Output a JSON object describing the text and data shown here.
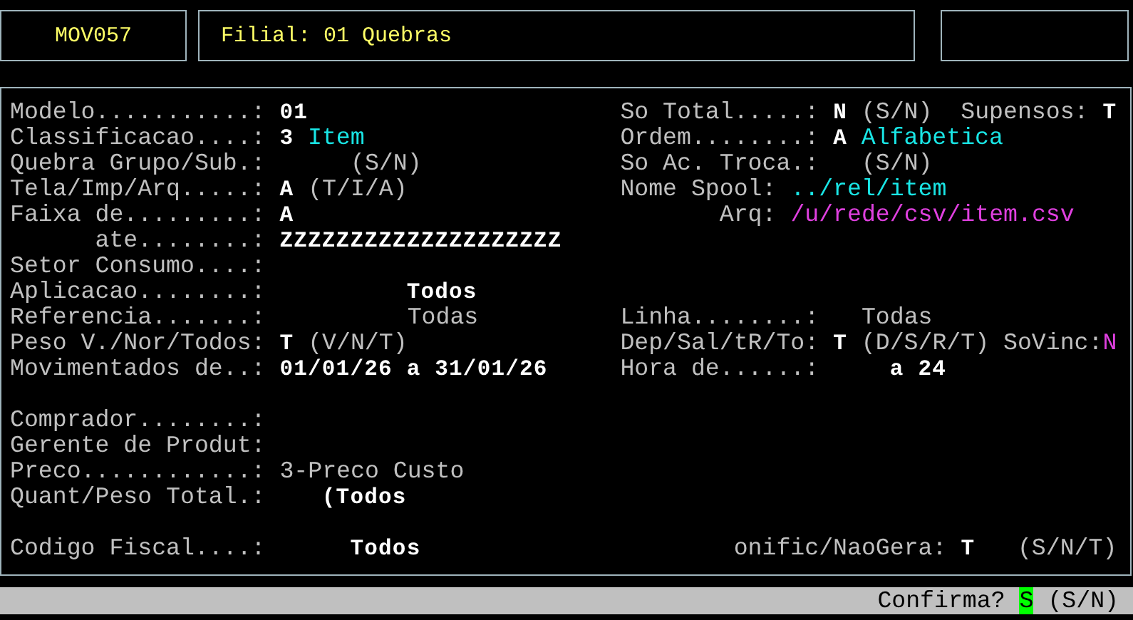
{
  "header": {
    "program_code": "MOV057",
    "title": "Filial: 01 Quebras"
  },
  "lines": [
    {
      "kind": "fields",
      "left": [
        {
          "text": "Modelo...........: ",
          "kind": "label"
        },
        {
          "text": "01",
          "kind": "value"
        }
      ],
      "right": [
        {
          "text": "So Total.....: ",
          "kind": "label"
        },
        {
          "text": "N",
          "kind": "value"
        },
        {
          "text": " (S/N)  Supensos: ",
          "kind": "label"
        },
        {
          "text": "T",
          "kind": "value"
        }
      ]
    },
    {
      "kind": "fields",
      "left": [
        {
          "text": "Classificacao....: ",
          "kind": "label"
        },
        {
          "text": "3 ",
          "kind": "value"
        },
        {
          "text": "Item",
          "kind": "cyan"
        }
      ],
      "right": [
        {
          "text": "Ordem........: ",
          "kind": "label"
        },
        {
          "text": "A ",
          "kind": "value"
        },
        {
          "text": "Alfabetica",
          "kind": "cyan"
        }
      ]
    },
    {
      "kind": "fields",
      "left": [
        {
          "text": "Quebra Grupo/Sub.:      (S/N)",
          "kind": "label"
        }
      ],
      "right": [
        {
          "text": "So Ac. Troca.:   (S/N)",
          "kind": "label"
        }
      ]
    },
    {
      "kind": "fields",
      "left": [
        {
          "text": "Tela/Imp/Arq.....: ",
          "kind": "label"
        },
        {
          "text": "A",
          "kind": "value"
        },
        {
          "text": " (T/I/A)",
          "kind": "label"
        }
      ],
      "right": [
        {
          "text": "Nome Spool: ",
          "kind": "label"
        },
        {
          "text": "../rel/item",
          "kind": "cyan"
        }
      ]
    },
    {
      "kind": "fields",
      "left": [
        {
          "text": "Faixa de.........: ",
          "kind": "label"
        },
        {
          "text": "A",
          "kind": "value"
        }
      ],
      "right": [
        {
          "text": "       Arq: ",
          "kind": "label"
        },
        {
          "text": "/u/rede/csv/item.csv",
          "kind": "magenta"
        }
      ]
    },
    {
      "kind": "fields",
      "left": [
        {
          "text": "      ate........: ",
          "kind": "label"
        },
        {
          "text": "ZZZZZZZZZZZZZZZZZZZZ",
          "kind": "value"
        }
      ]
    },
    {
      "kind": "fields",
      "left": [
        {
          "text": "Setor Consumo....:",
          "kind": "label"
        }
      ]
    },
    {
      "kind": "fields",
      "left": [
        {
          "text": "Aplicacao........: ",
          "kind": "label"
        },
        {
          "text": "         Todos",
          "kind": "value"
        }
      ]
    },
    {
      "kind": "fields",
      "left": [
        {
          "text": "Referencia.......: ",
          "kind": "label"
        },
        {
          "text": "         Todas",
          "kind": "label"
        }
      ],
      "right": [
        {
          "text": "Linha........:   Todas",
          "kind": "label"
        }
      ]
    },
    {
      "kind": "fields",
      "left": [
        {
          "text": "Peso V./Nor/Todos: ",
          "kind": "label"
        },
        {
          "text": "T",
          "kind": "value"
        },
        {
          "text": " (V/N/T)",
          "kind": "label"
        }
      ],
      "right": [
        {
          "text": "Dep/Sal/tR/To: ",
          "kind": "label"
        },
        {
          "text": "T",
          "kind": "value"
        },
        {
          "text": " (D/S/R/T) SoVinc:",
          "kind": "label"
        },
        {
          "text": "N",
          "kind": "magenta"
        }
      ]
    },
    {
      "kind": "fields",
      "left": [
        {
          "text": "Movimentados de..: ",
          "kind": "label"
        },
        {
          "text": "01/01/26 a 31/01/26",
          "kind": "value"
        }
      ],
      "right": [
        {
          "text": "Hora de......:     ",
          "kind": "label"
        },
        {
          "text": "a 24",
          "kind": "value"
        }
      ]
    },
    {
      "kind": "blank"
    },
    {
      "kind": "fields",
      "left": [
        {
          "text": "Comprador........:",
          "kind": "label"
        }
      ]
    },
    {
      "kind": "fields",
      "left": [
        {
          "text": "Gerente de Produt:",
          "kind": "label"
        }
      ]
    },
    {
      "kind": "fields",
      "left": [
        {
          "text": "Preco............: ",
          "kind": "label"
        },
        {
          "text": "3-Preco Custo",
          "kind": "label"
        }
      ]
    },
    {
      "kind": "fields",
      "left": [
        {
          "text": "Quant/Peso Total.: ",
          "kind": "label"
        },
        {
          "text": "   (Todos",
          "kind": "value"
        }
      ]
    },
    {
      "kind": "blank"
    },
    {
      "kind": "fields",
      "left": [
        {
          "text": "Codigo Fiscal....: ",
          "kind": "label"
        },
        {
          "text": "     Todos",
          "kind": "value"
        }
      ],
      "right": [
        {
          "text": "        onific/NaoGera: ",
          "kind": "label"
        },
        {
          "text": "T",
          "kind": "value"
        },
        {
          "text": "   (S/N/T)",
          "kind": "label"
        }
      ]
    }
  ],
  "status_bar": {
    "prompt": "Confirma? ",
    "answer": "S",
    "options": " (S/N)"
  }
}
